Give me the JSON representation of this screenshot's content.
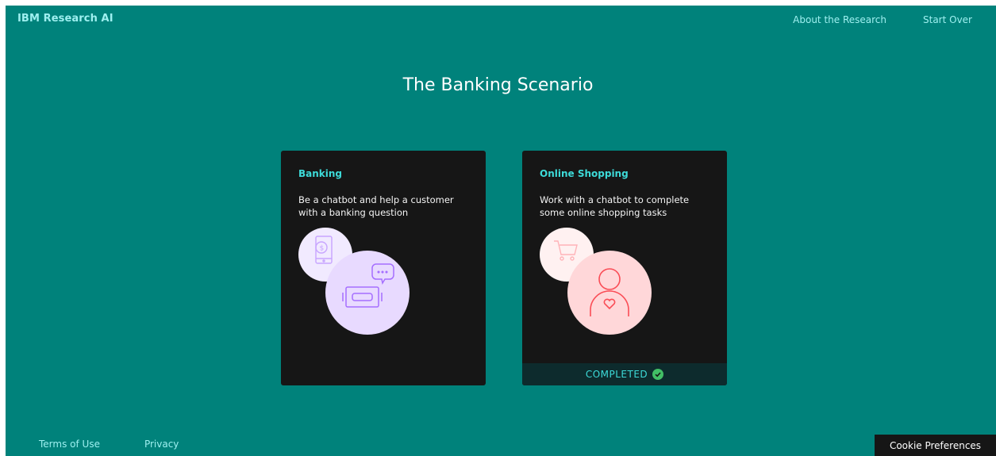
{
  "header": {
    "brand": "IBM Research AI",
    "nav": [
      "About the Research",
      "Start Over"
    ]
  },
  "page": {
    "title": "The Banking Scenario"
  },
  "cards": [
    {
      "title": "Banking",
      "description": "Be a chatbot and help a customer with a banking question",
      "illustration": "chatbot-banking-icon",
      "status": ""
    },
    {
      "title": "Online Shopping",
      "description": "Work with a chatbot to complete some online shopping tasks",
      "illustration": "shopping-customer-icon",
      "status": "COMPLETED"
    }
  ],
  "footer": {
    "links": [
      "Terms of Use",
      "Privacy"
    ],
    "cookie_button": "Cookie Preferences"
  },
  "colors": {
    "background": "#00827b",
    "card": "#161616",
    "accent_text": "#3ddbd9",
    "link": "#9ef0f0",
    "completed_check": "#42be65",
    "banking_light": "#f1eaff",
    "banking_circle": "#e8daff",
    "banking_stroke": "#a56eff",
    "shopping_light": "#fff1f1",
    "shopping_circle": "#ffd7d9",
    "shopping_stroke": "#fa4d56"
  }
}
